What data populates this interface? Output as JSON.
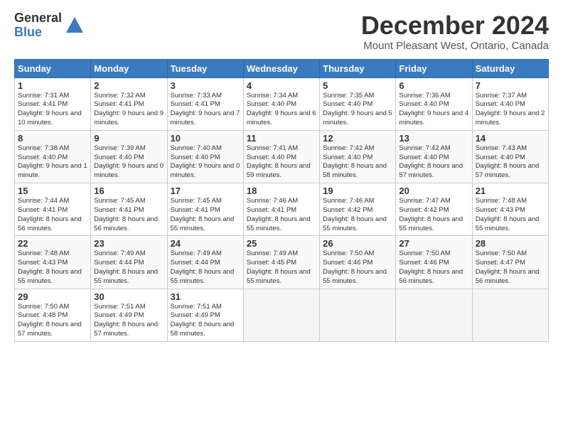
{
  "logo": {
    "general": "General",
    "blue": "Blue"
  },
  "title": "December 2024",
  "location": "Mount Pleasant West, Ontario, Canada",
  "days_header": [
    "Sunday",
    "Monday",
    "Tuesday",
    "Wednesday",
    "Thursday",
    "Friday",
    "Saturday"
  ],
  "weeks": [
    [
      {
        "day": "1",
        "sunrise": "Sunrise: 7:31 AM",
        "sunset": "Sunset: 4:41 PM",
        "daylight": "Daylight: 9 hours and 10 minutes."
      },
      {
        "day": "2",
        "sunrise": "Sunrise: 7:32 AM",
        "sunset": "Sunset: 4:41 PM",
        "daylight": "Daylight: 9 hours and 9 minutes."
      },
      {
        "day": "3",
        "sunrise": "Sunrise: 7:33 AM",
        "sunset": "Sunset: 4:41 PM",
        "daylight": "Daylight: 9 hours and 7 minutes."
      },
      {
        "day": "4",
        "sunrise": "Sunrise: 7:34 AM",
        "sunset": "Sunset: 4:40 PM",
        "daylight": "Daylight: 9 hours and 6 minutes."
      },
      {
        "day": "5",
        "sunrise": "Sunrise: 7:35 AM",
        "sunset": "Sunset: 4:40 PM",
        "daylight": "Daylight: 9 hours and 5 minutes."
      },
      {
        "day": "6",
        "sunrise": "Sunrise: 7:36 AM",
        "sunset": "Sunset: 4:40 PM",
        "daylight": "Daylight: 9 hours and 4 minutes."
      },
      {
        "day": "7",
        "sunrise": "Sunrise: 7:37 AM",
        "sunset": "Sunset: 4:40 PM",
        "daylight": "Daylight: 9 hours and 2 minutes."
      }
    ],
    [
      {
        "day": "8",
        "sunrise": "Sunrise: 7:38 AM",
        "sunset": "Sunset: 4:40 PM",
        "daylight": "Daylight: 9 hours and 1 minute."
      },
      {
        "day": "9",
        "sunrise": "Sunrise: 7:39 AM",
        "sunset": "Sunset: 4:40 PM",
        "daylight": "Daylight: 9 hours and 0 minutes."
      },
      {
        "day": "10",
        "sunrise": "Sunrise: 7:40 AM",
        "sunset": "Sunset: 4:40 PM",
        "daylight": "Daylight: 9 hours and 0 minutes."
      },
      {
        "day": "11",
        "sunrise": "Sunrise: 7:41 AM",
        "sunset": "Sunset: 4:40 PM",
        "daylight": "Daylight: 8 hours and 59 minutes."
      },
      {
        "day": "12",
        "sunrise": "Sunrise: 7:42 AM",
        "sunset": "Sunset: 4:40 PM",
        "daylight": "Daylight: 8 hours and 58 minutes."
      },
      {
        "day": "13",
        "sunrise": "Sunrise: 7:42 AM",
        "sunset": "Sunset: 4:40 PM",
        "daylight": "Daylight: 8 hours and 57 minutes."
      },
      {
        "day": "14",
        "sunrise": "Sunrise: 7:43 AM",
        "sunset": "Sunset: 4:40 PM",
        "daylight": "Daylight: 8 hours and 57 minutes."
      }
    ],
    [
      {
        "day": "15",
        "sunrise": "Sunrise: 7:44 AM",
        "sunset": "Sunset: 4:41 PM",
        "daylight": "Daylight: 8 hours and 56 minutes."
      },
      {
        "day": "16",
        "sunrise": "Sunrise: 7:45 AM",
        "sunset": "Sunset: 4:41 PM",
        "daylight": "Daylight: 8 hours and 56 minutes."
      },
      {
        "day": "17",
        "sunrise": "Sunrise: 7:45 AM",
        "sunset": "Sunset: 4:41 PM",
        "daylight": "Daylight: 8 hours and 55 minutes."
      },
      {
        "day": "18",
        "sunrise": "Sunrise: 7:46 AM",
        "sunset": "Sunset: 4:41 PM",
        "daylight": "Daylight: 8 hours and 55 minutes."
      },
      {
        "day": "19",
        "sunrise": "Sunrise: 7:46 AM",
        "sunset": "Sunset: 4:42 PM",
        "daylight": "Daylight: 8 hours and 55 minutes."
      },
      {
        "day": "20",
        "sunrise": "Sunrise: 7:47 AM",
        "sunset": "Sunset: 4:42 PM",
        "daylight": "Daylight: 8 hours and 55 minutes."
      },
      {
        "day": "21",
        "sunrise": "Sunrise: 7:48 AM",
        "sunset": "Sunset: 4:43 PM",
        "daylight": "Daylight: 8 hours and 55 minutes."
      }
    ],
    [
      {
        "day": "22",
        "sunrise": "Sunrise: 7:48 AM",
        "sunset": "Sunset: 4:43 PM",
        "daylight": "Daylight: 8 hours and 55 minutes."
      },
      {
        "day": "23",
        "sunrise": "Sunrise: 7:49 AM",
        "sunset": "Sunset: 4:44 PM",
        "daylight": "Daylight: 8 hours and 55 minutes."
      },
      {
        "day": "24",
        "sunrise": "Sunrise: 7:49 AM",
        "sunset": "Sunset: 4:44 PM",
        "daylight": "Daylight: 8 hours and 55 minutes."
      },
      {
        "day": "25",
        "sunrise": "Sunrise: 7:49 AM",
        "sunset": "Sunset: 4:45 PM",
        "daylight": "Daylight: 8 hours and 55 minutes."
      },
      {
        "day": "26",
        "sunrise": "Sunrise: 7:50 AM",
        "sunset": "Sunset: 4:46 PM",
        "daylight": "Daylight: 8 hours and 55 minutes."
      },
      {
        "day": "27",
        "sunrise": "Sunrise: 7:50 AM",
        "sunset": "Sunset: 4:46 PM",
        "daylight": "Daylight: 8 hours and 56 minutes."
      },
      {
        "day": "28",
        "sunrise": "Sunrise: 7:50 AM",
        "sunset": "Sunset: 4:47 PM",
        "daylight": "Daylight: 8 hours and 56 minutes."
      }
    ],
    [
      {
        "day": "29",
        "sunrise": "Sunrise: 7:50 AM",
        "sunset": "Sunset: 4:48 PM",
        "daylight": "Daylight: 8 hours and 57 minutes."
      },
      {
        "day": "30",
        "sunrise": "Sunrise: 7:51 AM",
        "sunset": "Sunset: 4:49 PM",
        "daylight": "Daylight: 8 hours and 57 minutes."
      },
      {
        "day": "31",
        "sunrise": "Sunrise: 7:51 AM",
        "sunset": "Sunset: 4:49 PM",
        "daylight": "Daylight: 8 hours and 58 minutes."
      },
      null,
      null,
      null,
      null
    ]
  ]
}
